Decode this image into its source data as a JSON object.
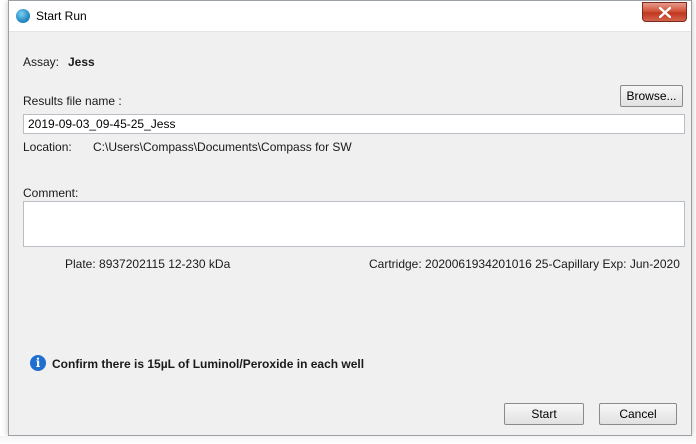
{
  "window": {
    "title": "Start Run"
  },
  "assay": {
    "label": "Assay:",
    "value": "Jess"
  },
  "results": {
    "label": "Results file name :",
    "filename": "2019-09-03_09-45-25_Jess",
    "browse_label": "Browse..."
  },
  "location": {
    "label": "Location:",
    "path": "C:\\Users\\Compass\\Documents\\Compass for SW"
  },
  "comment": {
    "label": "Comment:",
    "value": ""
  },
  "plate": {
    "text": "Plate: 8937202115  12-230 kDa"
  },
  "cartridge": {
    "text": "Cartridge: 2020061934201016   25-Capillary  Exp: Jun-2020"
  },
  "notice": {
    "text": "Confirm there is 15µL of Luminol/Peroxide in each well"
  },
  "footer": {
    "start_label": "Start",
    "cancel_label": "Cancel"
  },
  "colors": {
    "info": "#1f6fd1",
    "close": "#c1371f",
    "window_bg": "#f0f0f0"
  }
}
